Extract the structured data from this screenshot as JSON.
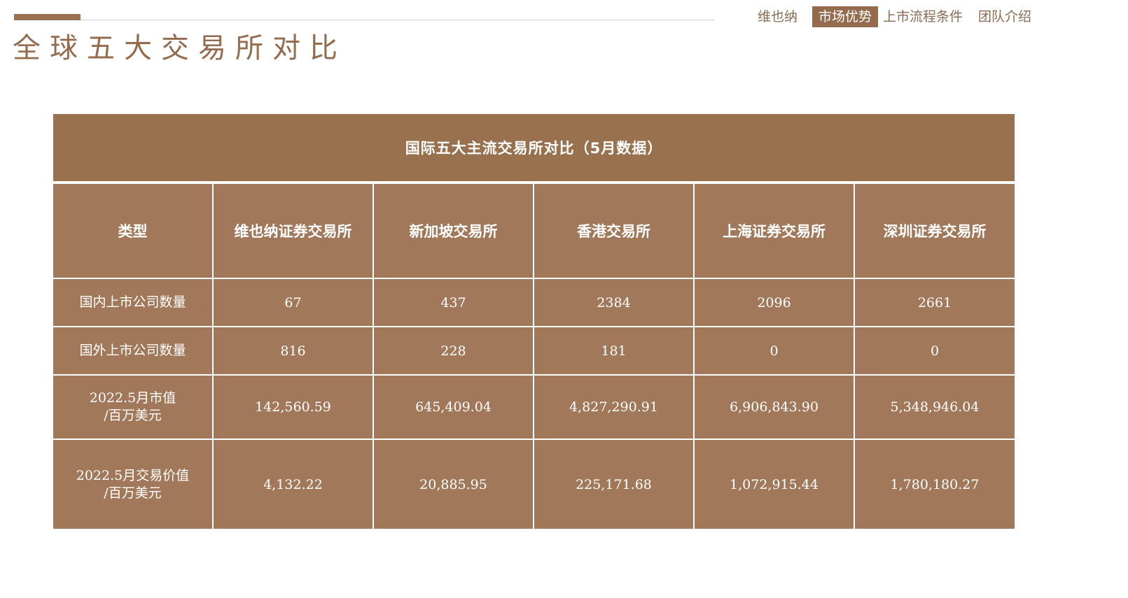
{
  "header": {
    "title": "全球五大交易所对比"
  },
  "nav": {
    "items": [
      {
        "label": "维也纳",
        "active": false
      },
      {
        "label": "市场优势",
        "active": true
      },
      {
        "label": "上市流程条件",
        "active": false
      },
      {
        "label": "团队介绍",
        "active": false
      }
    ]
  },
  "table": {
    "title": "国际五大主流交易所对比（5月数据）",
    "columns": [
      "类型",
      "维也纳证券交易所",
      "新加坡交易所",
      "香港交易所",
      "上海证券交易所",
      "深圳证券交易所"
    ],
    "rows": [
      {
        "label": "国内上市公司数量",
        "values": [
          "67",
          "437",
          "2384",
          "2096",
          "2661"
        ]
      },
      {
        "label": "国外上市公司数量",
        "values": [
          "816",
          "228",
          "181",
          "0",
          "0"
        ]
      },
      {
        "label": "2022.5月市值\n/百万美元",
        "values": [
          "142,560.59",
          "645,409.04",
          "4,827,290.91",
          "6,906,843.90",
          "5,348,946.04"
        ]
      },
      {
        "label": "2022.5月交易价值\n/百万美元",
        "values": [
          "4,132.22",
          "20,885.95",
          "225,171.68",
          "1,072,915.44",
          "1,780,180.27"
        ]
      }
    ]
  },
  "colors": {
    "brand": "#946b4c",
    "table_title_bg": "#98714f",
    "table_cell_bg": "#a1795a"
  }
}
